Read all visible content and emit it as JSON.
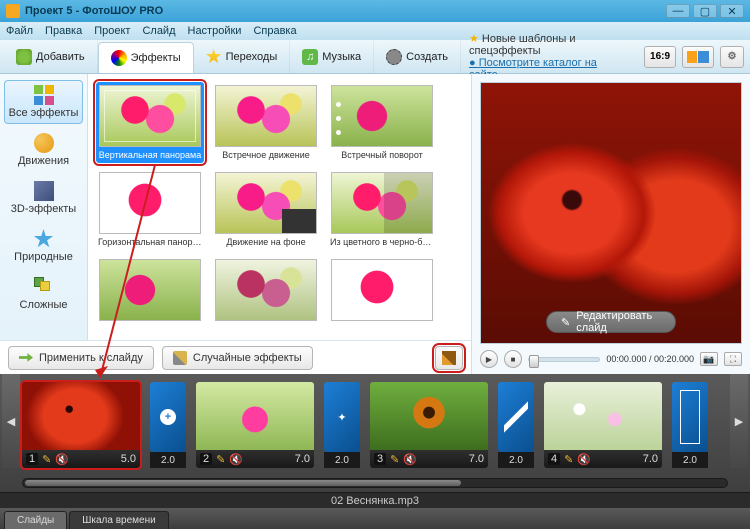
{
  "window": {
    "title": "Проект 5 - ФотоШОУ PRO"
  },
  "menu": [
    "Файл",
    "Правка",
    "Проект",
    "Слайд",
    "Настройки",
    "Справка"
  ],
  "tabs": {
    "add": "Добавить",
    "effects": "Эффекты",
    "transitions": "Переходы",
    "music": "Музыка",
    "create": "Создать"
  },
  "promo": {
    "line1": "Новые шаблоны и спецэффекты",
    "line2": "Посмотрите каталог на сайте..."
  },
  "aspect": "16:9",
  "categories": {
    "all": "Все эффекты",
    "motion": "Движения",
    "three_d": "3D-эффекты",
    "nature": "Природные",
    "complex": "Сложные"
  },
  "effects": [
    "Вертикальная панорама",
    "Встречное движение",
    "Встречный поворот",
    "Горизонтальная панорама",
    "Движение на фоне",
    "Из цветного в черно-белое",
    "",
    "",
    ""
  ],
  "actions": {
    "apply": "Применить к слайду",
    "random": "Случайные эффекты"
  },
  "preview": {
    "edit": "Редактировать слайд",
    "time": "00:00.000 / 00:20.000"
  },
  "timeline": {
    "slides": [
      {
        "n": "1",
        "dur": "5.0"
      },
      {
        "n": "2",
        "dur": "7.0"
      },
      {
        "n": "3",
        "dur": "7.0"
      },
      {
        "n": "4",
        "dur": "7.0"
      }
    ],
    "trans": [
      "2.0",
      "2.0",
      "2.0",
      "2.0"
    ]
  },
  "audio": "02 Веснянка.mp3",
  "bottom_tabs": {
    "slides": "Слайды",
    "timeline": "Шкала времени"
  }
}
